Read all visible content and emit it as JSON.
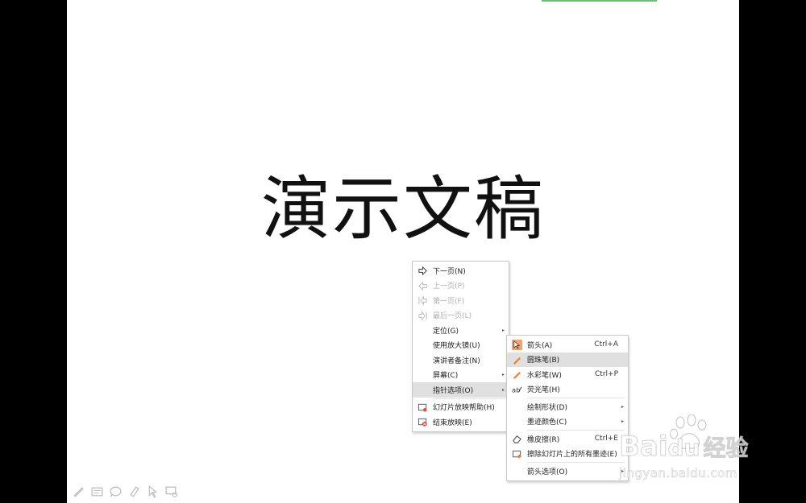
{
  "slide": {
    "title": "演示文稿"
  },
  "context_menu": {
    "items": [
      {
        "label": "下一页(N)",
        "icon": "arrow-right-icon",
        "disabled": false
      },
      {
        "label": "上一页(P)",
        "icon": "arrow-left-icon",
        "disabled": true
      },
      {
        "label": "第一页(F)",
        "icon": "first-page-icon",
        "disabled": true
      },
      {
        "label": "最后一页(L)",
        "icon": "last-page-icon",
        "disabled": true
      },
      {
        "label": "定位(G)",
        "submenu": true
      },
      {
        "label": "使用放大镜(U)"
      },
      {
        "label": "演讲者备注(N)"
      },
      {
        "label": "屏幕(C)",
        "submenu": true
      },
      {
        "label": "指针选项(O)",
        "submenu": true,
        "highlighted": true
      },
      {
        "label": "幻灯片放映帮助(H)",
        "icon": "help-icon"
      },
      {
        "label": "结束放映(E)",
        "icon": "end-show-icon"
      }
    ]
  },
  "pointer_submenu": {
    "items": [
      {
        "label": "箭头(A)",
        "shortcut": "Ctrl+A",
        "icon": "arrow-pointer-icon",
        "checked": true
      },
      {
        "label": "圆珠笔(B)",
        "icon": "ballpoint-pen-icon",
        "highlighted": true
      },
      {
        "label": "水彩笔(W)",
        "shortcut": "Ctrl+P",
        "icon": "watercolor-pen-icon"
      },
      {
        "label": "荧光笔(H)",
        "icon": "highlighter-icon"
      },
      {
        "label": "绘制形状(D)",
        "submenu": true
      },
      {
        "label": "墨迹颜色(C)",
        "submenu": true
      },
      {
        "label": "橡皮擦(R)",
        "shortcut": "Ctrl+E",
        "icon": "eraser-icon"
      },
      {
        "label": "擦除幻灯片上的所有墨迹(E)",
        "icon": "erase-all-icon"
      },
      {
        "label": "箭头选项(O)",
        "submenu": true
      }
    ]
  },
  "watermark": {
    "logo": "Bai",
    "logo_suffix": "du",
    "logo_cn": "经验",
    "url": "jingyan.baidu.com"
  },
  "colors": {
    "accent": "#f1a36b",
    "highlight": "#e0e0e0",
    "green_bar": "#6fbf73"
  }
}
